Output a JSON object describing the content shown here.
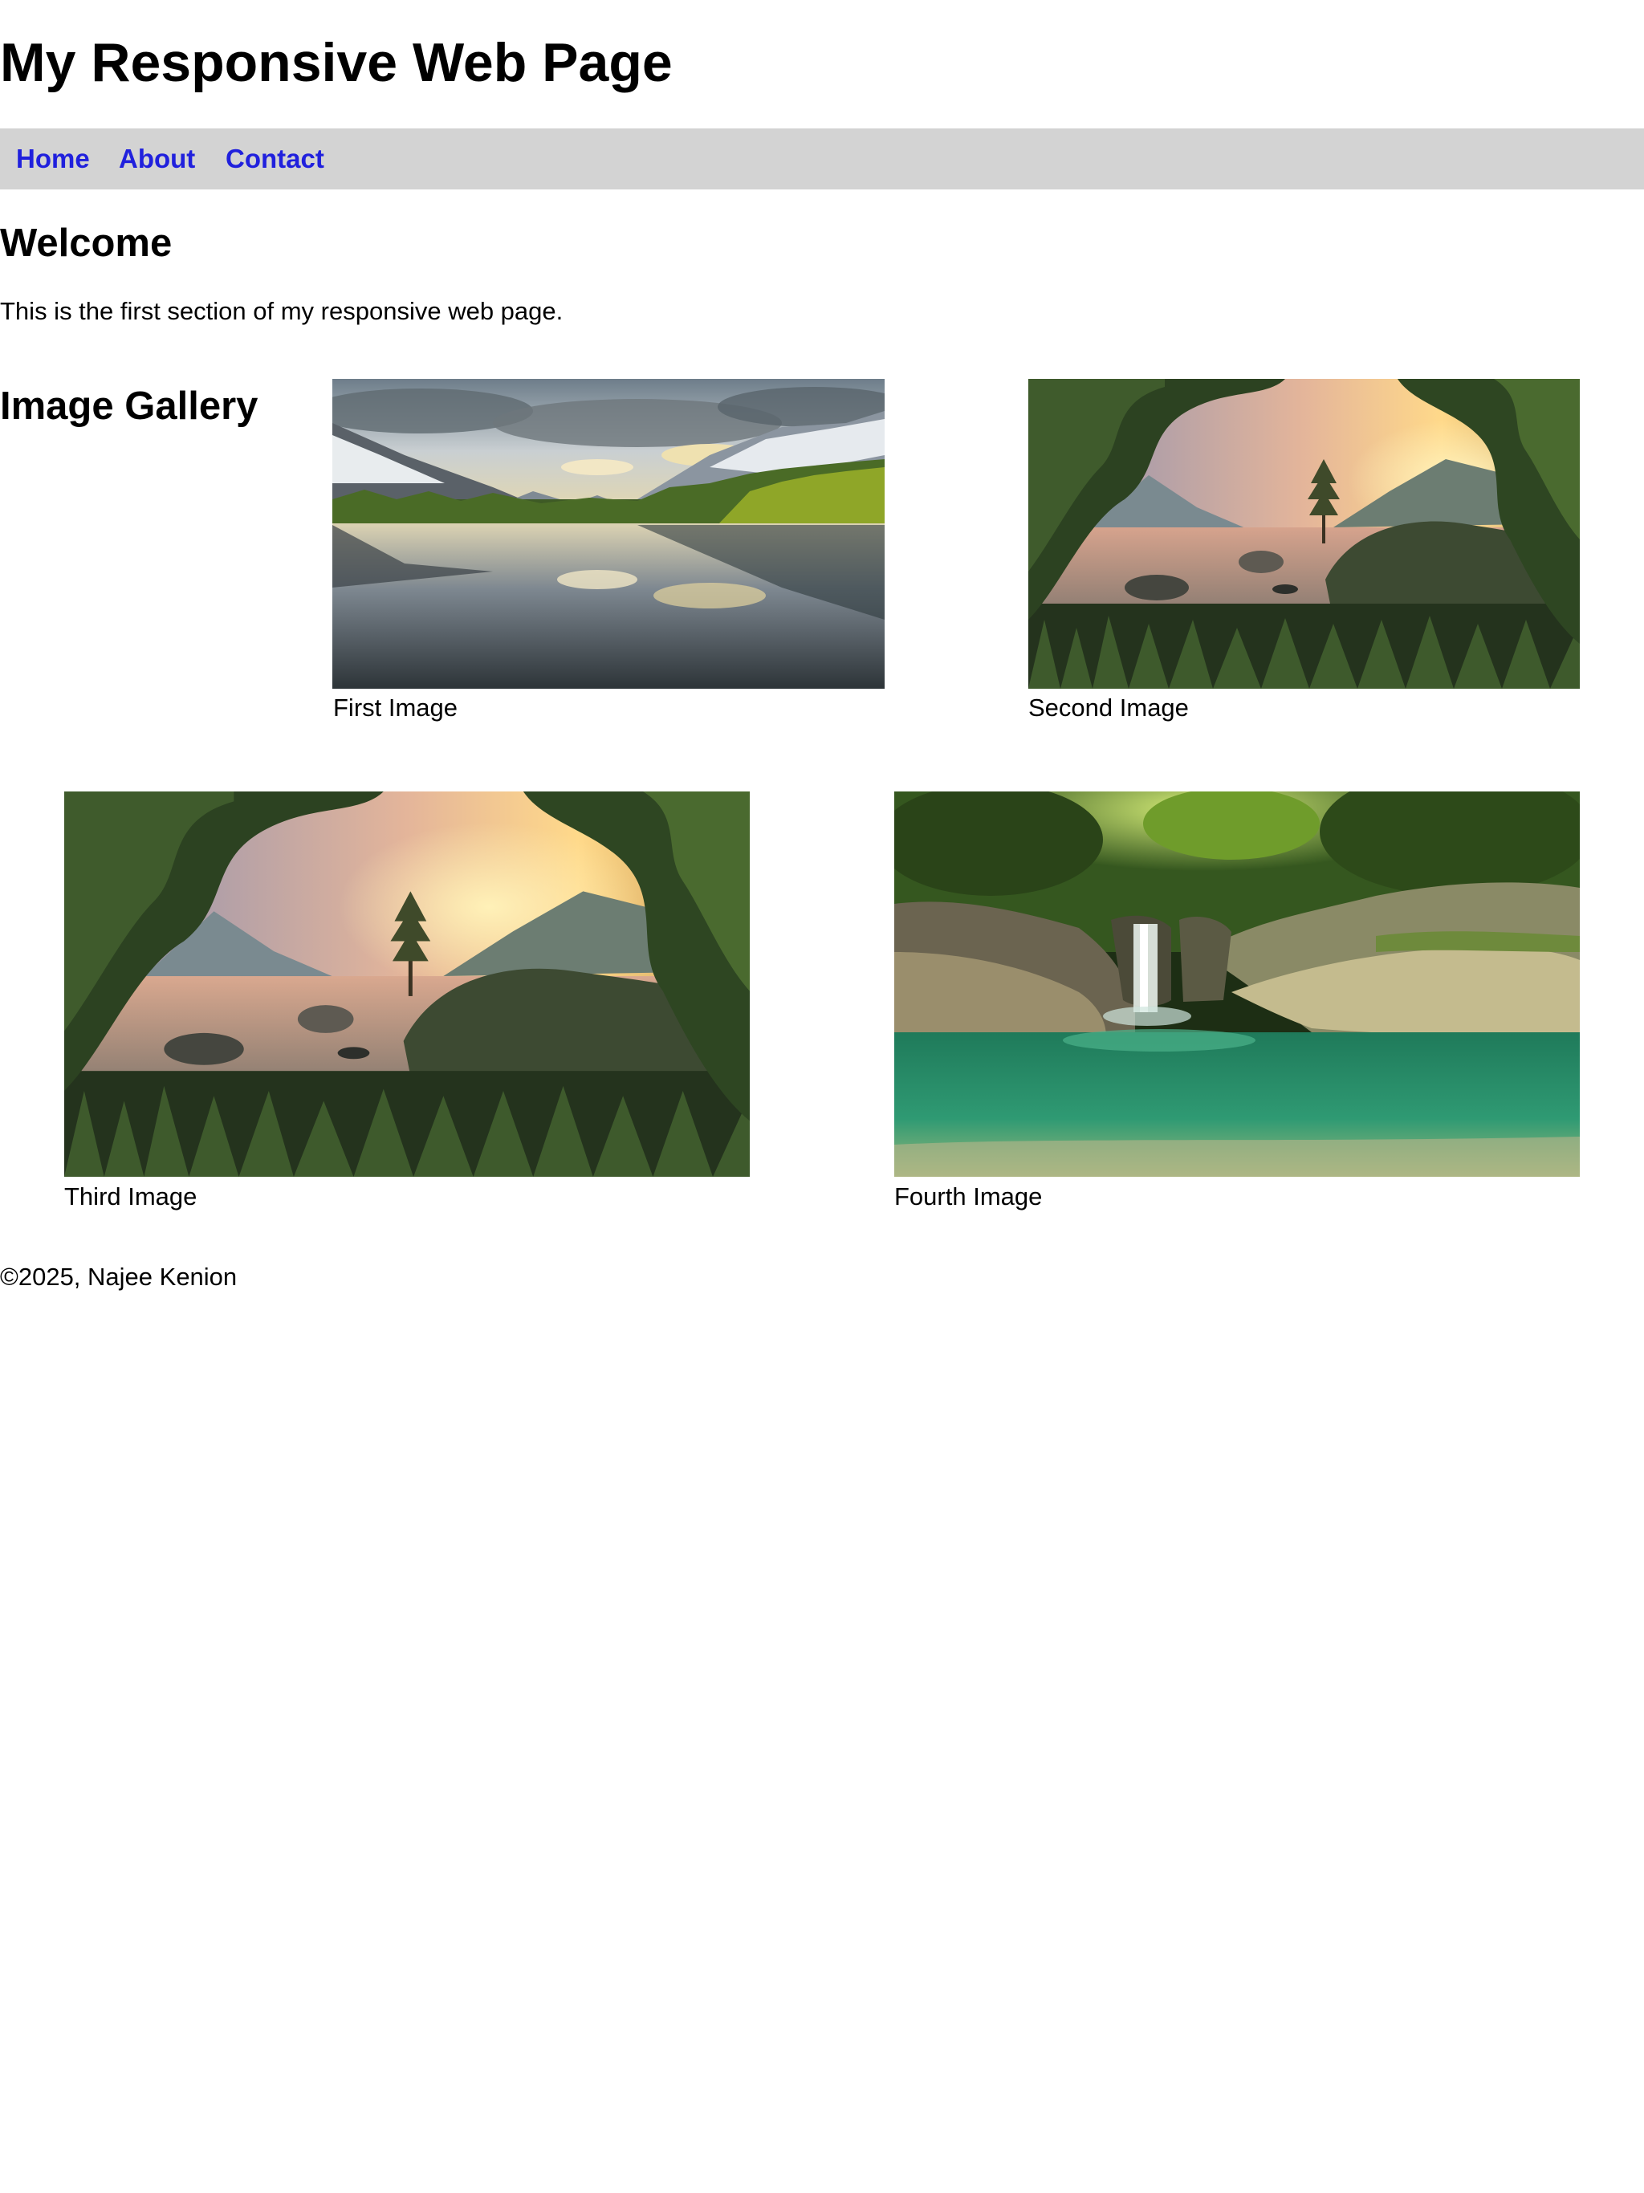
{
  "header": {
    "title": "My Responsive Web Page"
  },
  "nav": {
    "links": [
      {
        "label": "Home"
      },
      {
        "label": "About"
      },
      {
        "label": "Contact"
      }
    ],
    "link_color": "#2020dd",
    "background": "#d3d3d3"
  },
  "welcome": {
    "heading": "Welcome",
    "text": "This is the first section of my responsive web page."
  },
  "gallery": {
    "heading": "Image Gallery",
    "images": [
      {
        "caption": "First Image",
        "scene": "mountain-lake-reflection"
      },
      {
        "caption": "Second Image",
        "scene": "lake-sunset-trees"
      },
      {
        "caption": "Third Image",
        "scene": "lake-sunset-trees"
      },
      {
        "caption": "Fourth Image",
        "scene": "forest-waterfall-pool"
      }
    ]
  },
  "footer": {
    "text": "©2025, Najee Kenion"
  }
}
